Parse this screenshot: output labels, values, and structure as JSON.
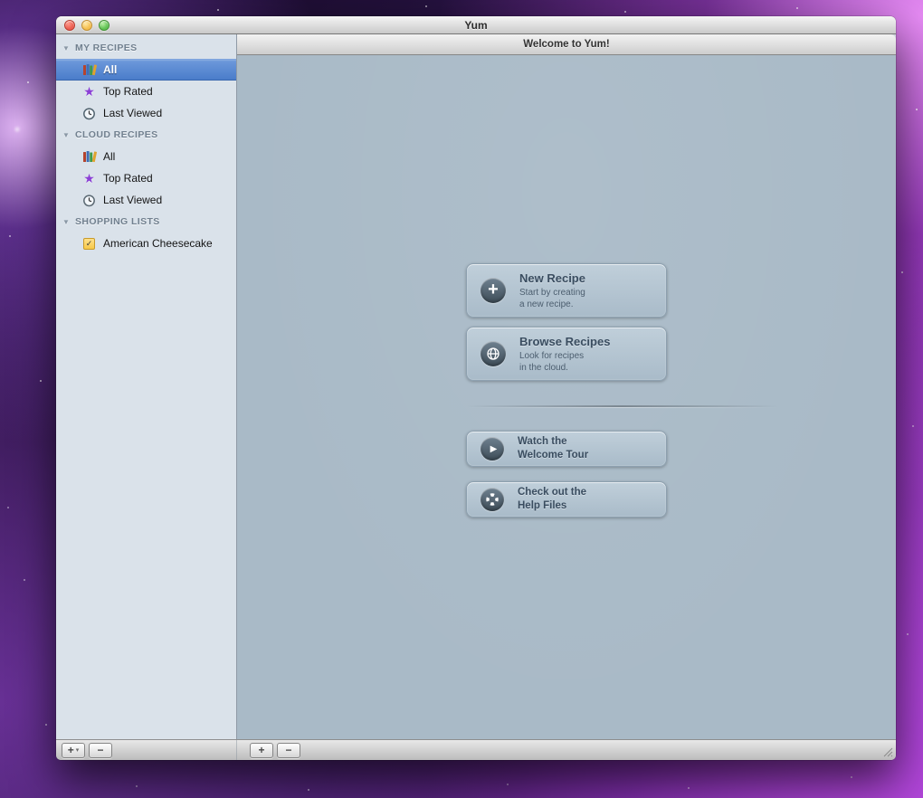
{
  "window": {
    "title": "Yum"
  },
  "icons": {
    "disclosure": "▼",
    "dropdown": "▾",
    "star": "★",
    "play": "▶",
    "plus_badge": "+",
    "note_check": "✓"
  },
  "colors": {
    "selection": "#4c7ecb",
    "content-bg": "#a9bac7",
    "sidebar-bg": "#dae2ea",
    "action-title": "#3a4d60",
    "action-subtitle": "#4c5e6f",
    "star": "#8b3fd6",
    "note": "#f7c948"
  },
  "sidebar": {
    "sections": [
      {
        "header": "MY RECIPES",
        "items": [
          {
            "label": "All",
            "icon": "books-icon",
            "selected": true
          },
          {
            "label": "Top Rated",
            "icon": "star-icon",
            "selected": false
          },
          {
            "label": "Last Viewed",
            "icon": "clock-icon",
            "selected": false
          }
        ]
      },
      {
        "header": "CLOUD RECIPES",
        "items": [
          {
            "label": "All",
            "icon": "books-icon",
            "selected": false
          },
          {
            "label": "Top Rated",
            "icon": "star-icon",
            "selected": false
          },
          {
            "label": "Last Viewed",
            "icon": "clock-icon",
            "selected": false
          }
        ]
      },
      {
        "header": "SHOPPING LISTS",
        "items": [
          {
            "label": "American Cheesecake",
            "icon": "note-icon",
            "selected": false
          }
        ]
      }
    ]
  },
  "main": {
    "header": "Welcome to Yum!",
    "actions": [
      {
        "title": "New Recipe",
        "subtitle": "Start by creating\na new recipe.",
        "icon": "plus-circle-icon"
      },
      {
        "title": "Browse Recipes",
        "subtitle": "Look for recipes\nin the cloud.",
        "icon": "globe-icon"
      }
    ],
    "secondary_actions": [
      {
        "title": "Watch the\nWelcome Tour",
        "icon": "play-circle-icon"
      },
      {
        "title": "Check out the\nHelp Files",
        "icon": "help-ring-icon"
      }
    ]
  },
  "bottom_bar": {
    "sidebar_controls": {
      "add": "+",
      "remove": "−"
    },
    "main_controls": {
      "add": "+",
      "remove": "−"
    }
  }
}
